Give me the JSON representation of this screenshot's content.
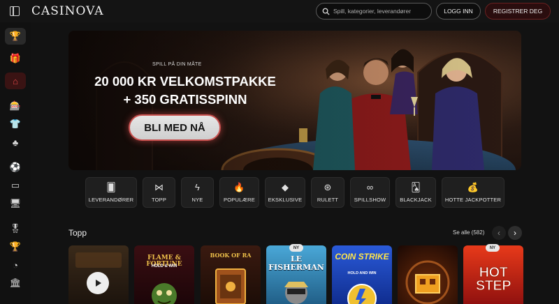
{
  "header": {
    "logo": "CASINOVA",
    "search_placeholder": "Spill, kategorier, leverandører",
    "login_label": "LOGG INN",
    "register_label": "REGISTRER DEG"
  },
  "sidebar": {
    "items": [
      {
        "icon": "trophy-icon",
        "glyph": "🏆"
      },
      {
        "icon": "gift-icon",
        "glyph": "🎁"
      },
      {
        "icon": "casino-icon",
        "glyph": "⌂"
      },
      {
        "icon": "slot-machine-icon",
        "glyph": "🎰"
      },
      {
        "icon": "tshirt-icon",
        "glyph": "👕"
      },
      {
        "icon": "clover-icon",
        "glyph": "♣"
      },
      {
        "icon": "soccer-ball-icon",
        "glyph": "⚽"
      },
      {
        "icon": "live-icon",
        "glyph": "▭"
      },
      {
        "icon": "monitor-icon",
        "glyph": "🖥"
      },
      {
        "icon": "award-icon",
        "glyph": "🎖"
      },
      {
        "icon": "cup-icon",
        "glyph": "🏆"
      },
      {
        "icon": "pacman-icon",
        "glyph": "◔"
      },
      {
        "icon": "bank-icon",
        "glyph": "🏛"
      }
    ]
  },
  "hero": {
    "kicker": "SPILL PÅ DIN MÅTE",
    "title_line1": "20 000 KR VELKOMSTPAKKE",
    "title_line2": "+ 350 GRATISSPINN",
    "cta_label": "BLI MED NÅ"
  },
  "categories": [
    {
      "label": "LEVERANDØRER",
      "icon": "provider-card-icon",
      "glyph": "🂠"
    },
    {
      "label": "TOPP",
      "icon": "bowtie-icon",
      "glyph": "⋈"
    },
    {
      "label": "NYE",
      "icon": "lightning-icon",
      "glyph": "ϟ"
    },
    {
      "label": "POPULÆRE",
      "icon": "flame-icon",
      "glyph": "🔥"
    },
    {
      "label": "EKSKLUSIVE",
      "icon": "diamond-icon",
      "glyph": "◆"
    },
    {
      "label": "RULETT",
      "icon": "roulette-icon",
      "glyph": "⊛"
    },
    {
      "label": "SPILLSHOW",
      "icon": "mask-icon",
      "glyph": "∞"
    },
    {
      "label": "BLACKJACK",
      "icon": "cards-icon",
      "glyph": "🂡"
    },
    {
      "label": "HOTTE JACKPOTTER",
      "icon": "jackpot-bag-icon",
      "glyph": "💰"
    }
  ],
  "section": {
    "title": "Topp",
    "see_all": "Se alle (582)"
  },
  "games": [
    {
      "title": "",
      "badge": ""
    },
    {
      "title": "FLAME & FORTUNE",
      "subtitle": "HOLD & WIN",
      "badge": ""
    },
    {
      "title": "BOOK OF RA",
      "badge": ""
    },
    {
      "title": "LE FISHERMAN",
      "badge": "NY"
    },
    {
      "title": "COIN STRIKE",
      "subtitle": "HOLD AND WIN",
      "badge": ""
    },
    {
      "title": "",
      "badge": ""
    },
    {
      "title": "HOT STEP",
      "badge": "NY"
    }
  ],
  "colors": {
    "accent": "#c9514f",
    "background": "#121212"
  }
}
